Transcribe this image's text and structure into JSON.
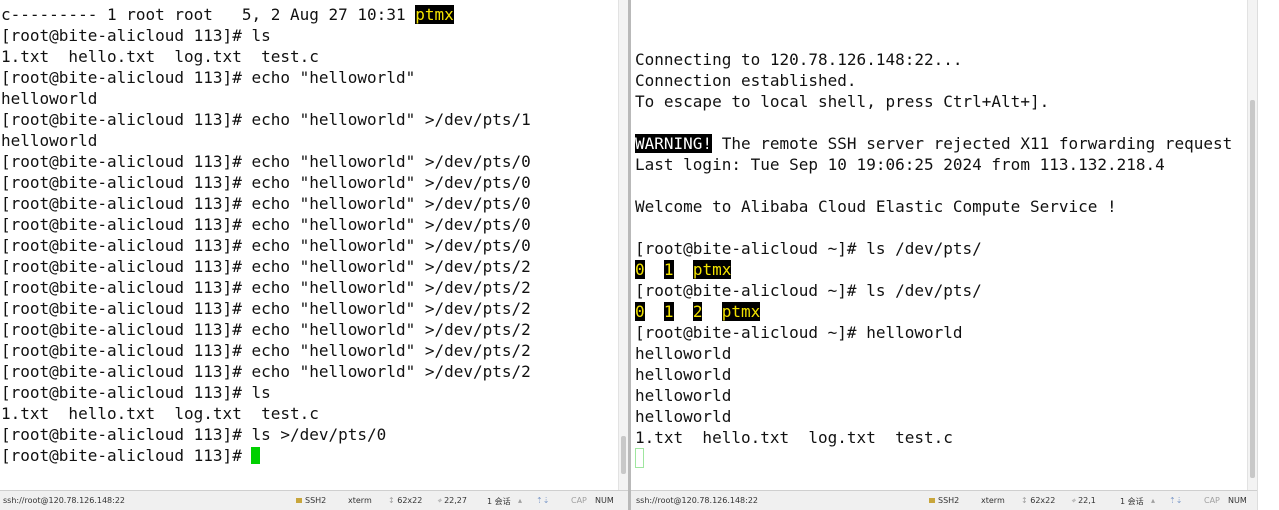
{
  "left_terminal": {
    "lines": [
      {
        "segments": [
          {
            "text": "c--------- 1 root root   5, 2 Aug 27 10:31 "
          },
          {
            "text": "ptmx",
            "style": "hl"
          }
        ]
      },
      {
        "segments": [
          {
            "text": "[root@bite-alicloud 113]# ls"
          }
        ]
      },
      {
        "segments": [
          {
            "text": "1.txt  hello.txt  log.txt  test.c"
          }
        ]
      },
      {
        "segments": [
          {
            "text": "[root@bite-alicloud 113]# echo \"helloworld\""
          }
        ]
      },
      {
        "segments": [
          {
            "text": "helloworld"
          }
        ]
      },
      {
        "segments": [
          {
            "text": "[root@bite-alicloud 113]# echo \"helloworld\" >/dev/pts/1"
          }
        ]
      },
      {
        "segments": [
          {
            "text": "helloworld"
          }
        ]
      },
      {
        "segments": [
          {
            "text": "[root@bite-alicloud 113]# echo \"helloworld\" >/dev/pts/0"
          }
        ]
      },
      {
        "segments": [
          {
            "text": "[root@bite-alicloud 113]# echo \"helloworld\" >/dev/pts/0"
          }
        ]
      },
      {
        "segments": [
          {
            "text": "[root@bite-alicloud 113]# echo \"helloworld\" >/dev/pts/0"
          }
        ]
      },
      {
        "segments": [
          {
            "text": "[root@bite-alicloud 113]# echo \"helloworld\" >/dev/pts/0"
          }
        ]
      },
      {
        "segments": [
          {
            "text": "[root@bite-alicloud 113]# echo \"helloworld\" >/dev/pts/0"
          }
        ]
      },
      {
        "segments": [
          {
            "text": "[root@bite-alicloud 113]# echo \"helloworld\" >/dev/pts/2"
          }
        ]
      },
      {
        "segments": [
          {
            "text": "[root@bite-alicloud 113]# echo \"helloworld\" >/dev/pts/2"
          }
        ]
      },
      {
        "segments": [
          {
            "text": "[root@bite-alicloud 113]# echo \"helloworld\" >/dev/pts/2"
          }
        ]
      },
      {
        "segments": [
          {
            "text": "[root@bite-alicloud 113]# echo \"helloworld\" >/dev/pts/2"
          }
        ]
      },
      {
        "segments": [
          {
            "text": "[root@bite-alicloud 113]# echo \"helloworld\" >/dev/pts/2"
          }
        ]
      },
      {
        "segments": [
          {
            "text": "[root@bite-alicloud 113]# echo \"helloworld\" >/dev/pts/2"
          }
        ]
      },
      {
        "segments": [
          {
            "text": "[root@bite-alicloud 113]# ls"
          }
        ]
      },
      {
        "segments": [
          {
            "text": "1.txt  hello.txt  log.txt  test.c"
          }
        ]
      },
      {
        "segments": [
          {
            "text": "[root@bite-alicloud 113]# ls >/dev/pts/0"
          }
        ]
      },
      {
        "segments": [
          {
            "text": "[root@bite-alicloud 113]# "
          }
        ],
        "cursor": "block"
      }
    ],
    "status": {
      "connection": "ssh://root@120.78.126.148:22",
      "protocol": "SSH2",
      "term_type": "xterm",
      "size": "62x22",
      "position": "22,27",
      "sessions": "1 会话",
      "caps": "CAP",
      "num": "NUM"
    }
  },
  "right_terminal": {
    "lines": [
      {
        "segments": [
          {
            "text": "Connecting to 120.78.126.148:22..."
          }
        ]
      },
      {
        "segments": [
          {
            "text": "Connection established."
          }
        ]
      },
      {
        "segments": [
          {
            "text": "To escape to local shell, press Ctrl+Alt+]."
          }
        ]
      },
      {
        "segments": [
          {
            "text": ""
          }
        ]
      },
      {
        "segments": [
          {
            "text": "WARNING!",
            "style": "warn"
          },
          {
            "text": " The remote SSH server rejected X11 forwarding request"
          }
        ]
      },
      {
        "segments": [
          {
            "text": "Last login: Tue Sep 10 19:06:25 2024 from 113.132.218.4"
          }
        ]
      },
      {
        "segments": [
          {
            "text": ""
          }
        ]
      },
      {
        "segments": [
          {
            "text": "Welcome to Alibaba Cloud Elastic Compute Service !"
          }
        ]
      },
      {
        "segments": [
          {
            "text": ""
          }
        ]
      },
      {
        "segments": [
          {
            "text": "[root@bite-alicloud ~]# ls /dev/pts/"
          }
        ]
      },
      {
        "segments": [
          {
            "text": "0",
            "style": "hl"
          },
          {
            "text": "  "
          },
          {
            "text": "1",
            "style": "hl"
          },
          {
            "text": "  "
          },
          {
            "text": "ptmx",
            "style": "hl"
          }
        ]
      },
      {
        "segments": [
          {
            "text": "[root@bite-alicloud ~]# ls /dev/pts/"
          }
        ]
      },
      {
        "segments": [
          {
            "text": "0",
            "style": "hl"
          },
          {
            "text": "  "
          },
          {
            "text": "1",
            "style": "hl"
          },
          {
            "text": "  "
          },
          {
            "text": "2",
            "style": "hl"
          },
          {
            "text": "  "
          },
          {
            "text": "ptmx",
            "style": "hl"
          }
        ]
      },
      {
        "segments": [
          {
            "text": "[root@bite-alicloud ~]# helloworld"
          }
        ]
      },
      {
        "segments": [
          {
            "text": "helloworld"
          }
        ]
      },
      {
        "segments": [
          {
            "text": "helloworld"
          }
        ]
      },
      {
        "segments": [
          {
            "text": "helloworld"
          }
        ]
      },
      {
        "segments": [
          {
            "text": "helloworld"
          }
        ]
      },
      {
        "segments": [
          {
            "text": "1.txt  hello.txt  log.txt  test.c"
          }
        ]
      },
      {
        "segments": [
          {
            "text": ""
          }
        ],
        "cursor": "outline"
      }
    ],
    "status": {
      "connection": "ssh://root@120.78.126.148:22",
      "protocol": "SSH2",
      "term_type": "xterm",
      "size": "62x22",
      "position": "22,1",
      "sessions": "1 会话",
      "caps": "CAP",
      "num": "NUM"
    }
  },
  "colors": {
    "highlight_bg": "#000000",
    "highlight_fg": "#f2e200",
    "cursor": "#00d000",
    "text": "#111111"
  }
}
